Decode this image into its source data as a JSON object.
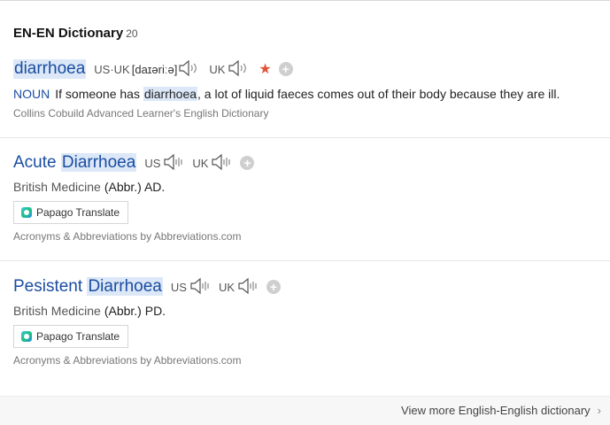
{
  "section": {
    "title": "EN-EN Dictionary",
    "count": "20"
  },
  "entries": [
    {
      "headword": "diarrhoea",
      "pron_label_us_uk": "US·UK",
      "ipa": "[daɪəriːə]",
      "pron_label_uk": "UK",
      "pos": "NOUN",
      "definition_before": "If someone has",
      "definition_highlight": "diarrhoea",
      "definition_after": ", a lot of liquid faeces comes out of their body because they are ill.",
      "source": "Collins Cobuild Advanced Learner's English Dictionary"
    },
    {
      "headword_prefix": "Acute",
      "headword_highlight": "Diarrhoea",
      "pron_us": "US",
      "pron_uk": "UK",
      "field": "British Medicine",
      "abbr": "(Abbr.) AD.",
      "translate": "Papago Translate",
      "source": "Acronyms & Abbreviations by Abbreviations.com"
    },
    {
      "headword_prefix": "Pesistent",
      "headword_highlight": "Diarrhoea",
      "pron_us": "US",
      "pron_uk": "UK",
      "field": "British Medicine",
      "abbr": "(Abbr.) PD.",
      "translate": "Papago Translate",
      "source": "Acronyms & Abbreviations by Abbreviations.com"
    }
  ],
  "footer": {
    "view_more": "View more English-English dictionary"
  },
  "colors": {
    "link": "#1a4da0",
    "highlight": "#dce8f8",
    "star": "#e0553a"
  },
  "icons": [
    "speaker-icon",
    "speaker-wave-icon",
    "star-icon",
    "plus-icon",
    "papago-logo-icon",
    "chevron-right-icon"
  ]
}
